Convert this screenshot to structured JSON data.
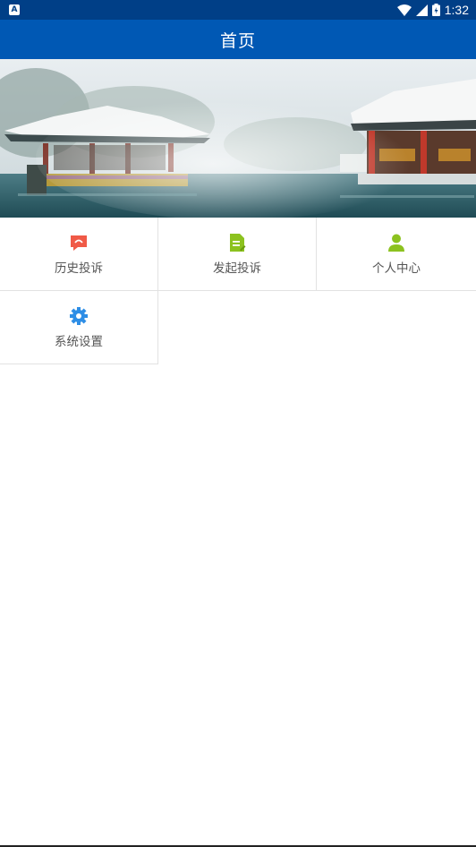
{
  "status_bar": {
    "notification_glyph": "A",
    "time": "1:32",
    "icons": [
      "wifi-icon",
      "signal-icon",
      "battery-icon"
    ]
  },
  "app_bar": {
    "title": "首页"
  },
  "banner": {
    "description_icon": "scenic-pavilion-image"
  },
  "menu": {
    "items": [
      {
        "label": "历史投诉",
        "icon": "chat-bubble-icon",
        "color": "#f05a47"
      },
      {
        "label": "发起投诉",
        "icon": "document-edit-icon",
        "color": "#8cc21f"
      },
      {
        "label": "个人中心",
        "icon": "person-icon",
        "color": "#8cc21f"
      },
      {
        "label": "系统设置",
        "icon": "gear-icon",
        "color": "#2e8ee6"
      }
    ]
  },
  "colors": {
    "status_bar": "#003f87",
    "app_bar": "#0058b4"
  }
}
